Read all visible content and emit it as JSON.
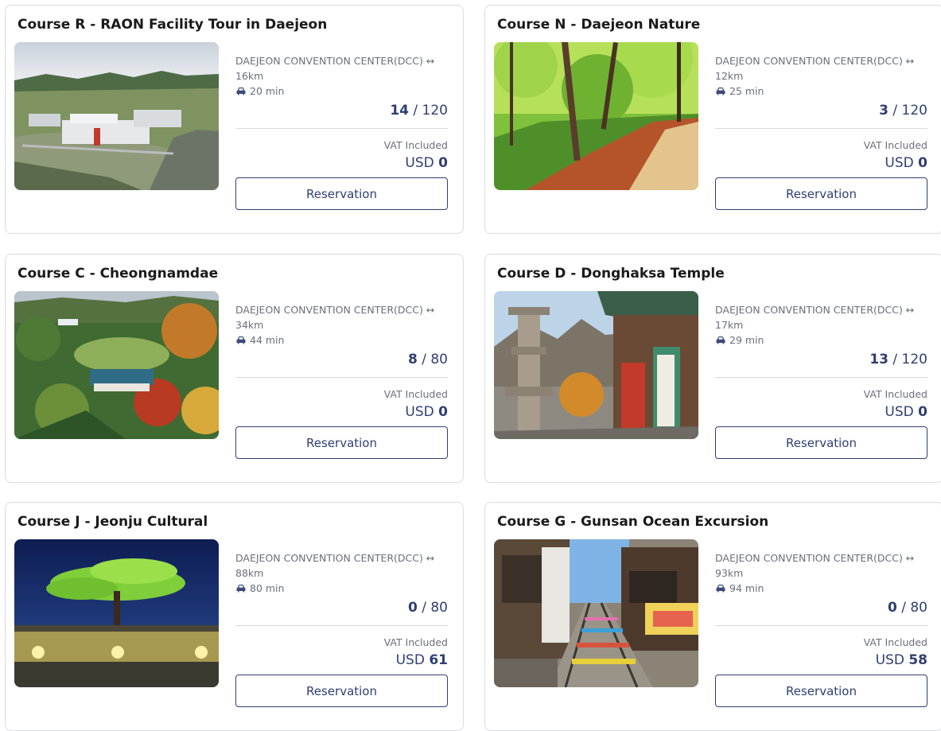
{
  "theme": {
    "accent": "#2f3f73",
    "muted": "#6b6f7a",
    "border": "#d9dce3"
  },
  "courses": [
    {
      "title": "Course R - RAON Facility Tour in Daejeon",
      "route_origin": "DAEJEON CONVENTION CENTER(DCC) ↔",
      "distance": "16km",
      "drive_time": "20 min",
      "booked": "14",
      "capacity": "/ 120",
      "vat_label": "VAT Included",
      "currency": "USD",
      "price": "0",
      "button_label": "Reservation",
      "image": "aerial-research-facility-photo"
    },
    {
      "title": "Course N - Daejeon Nature",
      "route_origin": "DAEJEON CONVENTION CENTER(DCC) ↔",
      "distance": "12km",
      "drive_time": "25 min",
      "booked": "3",
      "capacity": "/ 120",
      "vat_label": "VAT Included",
      "currency": "USD",
      "price": "0",
      "button_label": "Reservation",
      "image": "forest-trail-photo"
    },
    {
      "title": "Course C - Cheongnamdae",
      "route_origin": "DAEJEON CONVENTION CENTER(DCC) ↔",
      "distance": "34km",
      "drive_time": "44 min",
      "booked": "8",
      "capacity": "/ 80",
      "vat_label": "VAT Included",
      "currency": "USD",
      "price": "0",
      "button_label": "Reservation",
      "image": "autumn-villa-aerial-photo"
    },
    {
      "title": "Course D - Donghaksa Temple",
      "route_origin": "DAEJEON CONVENTION CENTER(DCC) ↔",
      "distance": "17km",
      "drive_time": "29 min",
      "booked": "13",
      "capacity": "/ 120",
      "vat_label": "VAT Included",
      "currency": "USD",
      "price": "0",
      "button_label": "Reservation",
      "image": "temple-pagoda-photo"
    },
    {
      "title": "Course J - Jeonju Cultural",
      "route_origin": "DAEJEON CONVENTION CENTER(DCC) ↔",
      "distance": "88km",
      "drive_time": "80 min",
      "booked": "0",
      "capacity": "/ 80",
      "vat_label": "VAT Included",
      "currency": "USD",
      "price": "61",
      "button_label": "Reservation",
      "image": "night-pine-tree-wall-photo"
    },
    {
      "title": "Course G - Gunsan Ocean Excursion",
      "route_origin": "DAEJEON CONVENTION CENTER(DCC) ↔",
      "distance": "93km",
      "drive_time": "94 min",
      "booked": "0",
      "capacity": "/ 80",
      "vat_label": "VAT Included",
      "currency": "USD",
      "price": "58",
      "button_label": "Reservation",
      "image": "railway-village-photo"
    }
  ]
}
